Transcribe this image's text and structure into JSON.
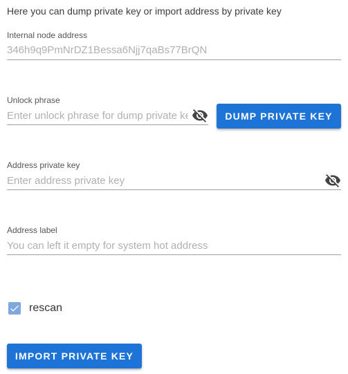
{
  "intro_text": "Here you can dump private key or import address by private key",
  "node_address": {
    "label": "Internal node address",
    "value": "346h9q9PmNrDZ1Bessa6Njj7qaBs77BrQN"
  },
  "unlock_phrase": {
    "label": "Unlock phrase",
    "placeholder": "Enter unlock phrase for dump private key",
    "visibility_icon": "eye-off-icon"
  },
  "dump_button": {
    "label": "DUMP PRIVATE KEY"
  },
  "private_key": {
    "label": "Address private key",
    "placeholder": "Enter address private key",
    "visibility_icon": "eye-off-icon"
  },
  "address_label": {
    "label": "Address label",
    "placeholder": "You can left it empty for system hot address"
  },
  "rescan": {
    "label": "rescan",
    "checked": true
  },
  "import_button": {
    "label": "IMPORT PRIVATE KEY"
  },
  "colors": {
    "accent": "#1e74d6",
    "checkbox": "#7fa7e0"
  }
}
